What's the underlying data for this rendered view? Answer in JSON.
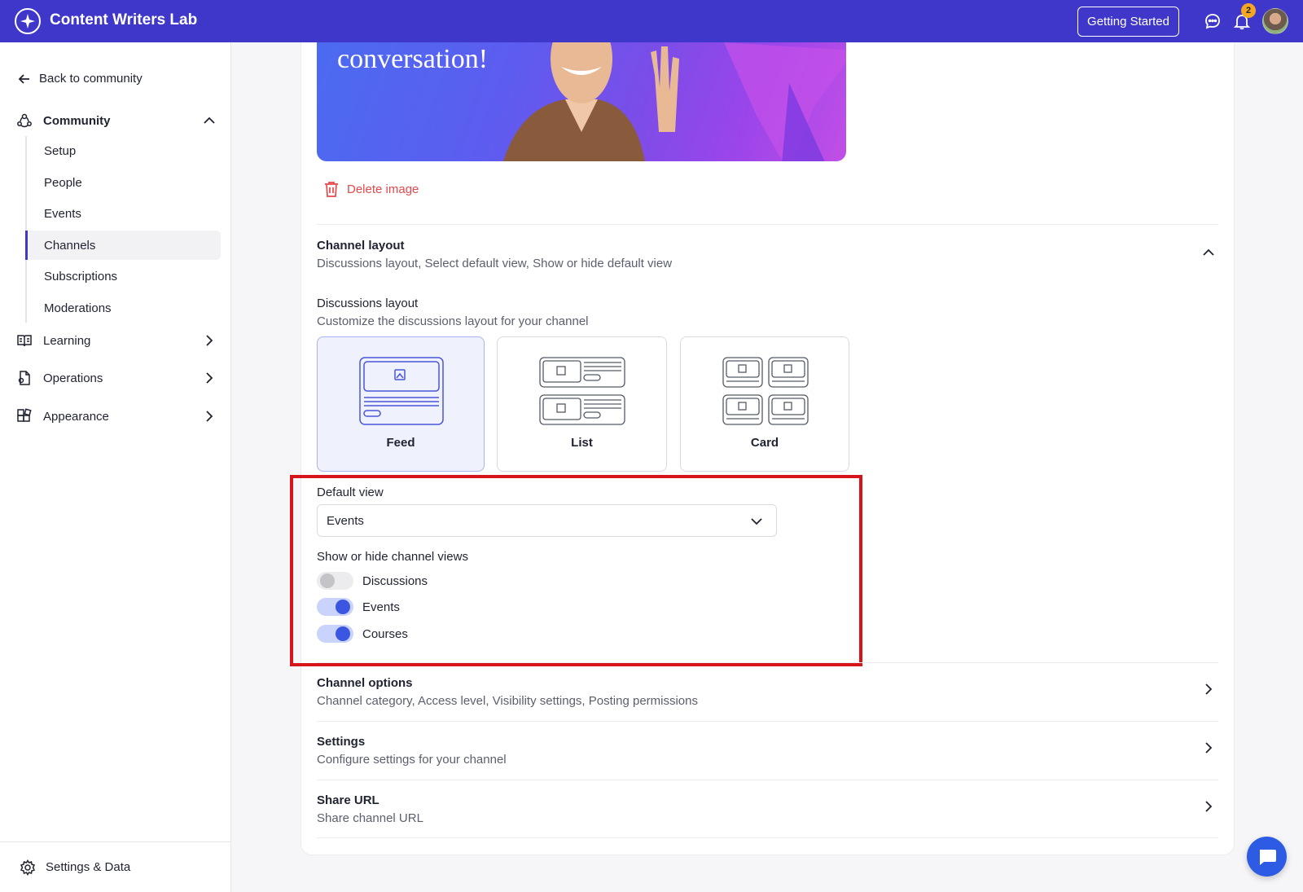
{
  "app": {
    "title": "Content Writers Lab",
    "getting_started": "Getting Started",
    "notification_count": "2"
  },
  "sidebar": {
    "back_label": "Back to community",
    "community_label": "Community",
    "sub_items": [
      "Setup",
      "People",
      "Events",
      "Channels",
      "Subscriptions",
      "Moderations"
    ],
    "active_item": "Channels",
    "learning_label": "Learning",
    "operations_label": "Operations",
    "appearance_label": "Appearance",
    "footer_label": "Settings & Data"
  },
  "banner": {
    "text": "conversation!"
  },
  "delete_image_label": "Delete image",
  "channel_layout": {
    "title": "Channel layout",
    "subtitle": "Discussions layout, Select default view, Show or hide default view",
    "discussions_layout_label": "Discussions layout",
    "discussions_layout_sub": "Customize the discussions layout for your channel",
    "options": [
      "Feed",
      "List",
      "Card"
    ],
    "selected_option": "Feed",
    "default_view_label": "Default view",
    "default_view_value": "Events",
    "show_hide_label": "Show or hide channel views",
    "toggles": [
      {
        "label": "Discussions",
        "on": false
      },
      {
        "label": "Events",
        "on": true
      },
      {
        "label": "Courses",
        "on": true
      }
    ]
  },
  "sections": [
    {
      "title": "Channel options",
      "subtitle": "Channel category, Access level, Visibility settings, Posting permissions"
    },
    {
      "title": "Settings",
      "subtitle": "Configure settings for your channel"
    },
    {
      "title": "Share URL",
      "subtitle": "Share channel URL"
    }
  ],
  "colors": {
    "brand": "#3f37c9",
    "accent": "#3b56e0",
    "danger": "#e5484d",
    "highlight": "#d7141a"
  }
}
